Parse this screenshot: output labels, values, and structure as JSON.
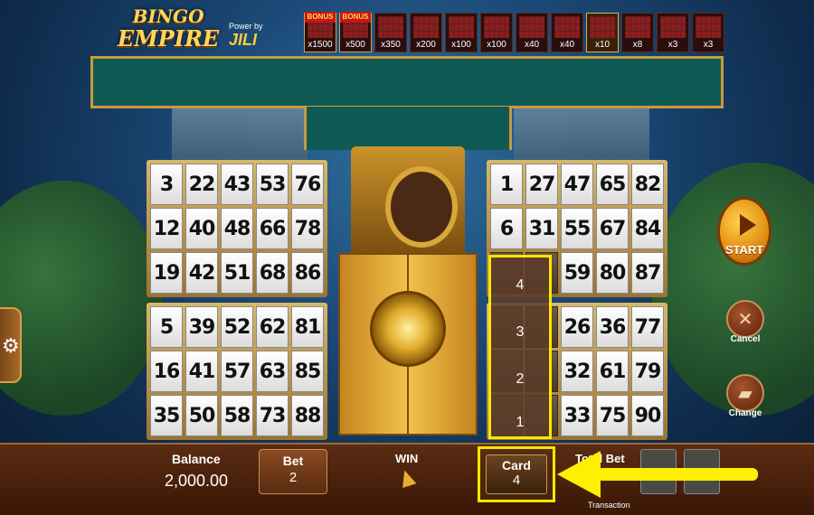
{
  "game": {
    "logo_line1": "BINGO",
    "logo_line2": "EMPIRE",
    "powered_by": "Power by",
    "brand": "JILI"
  },
  "patterns": [
    {
      "multiplier": "x1500",
      "bonus": "BONUS"
    },
    {
      "multiplier": "x500",
      "bonus": "BONUS"
    },
    {
      "multiplier": "x350",
      "bonus": ""
    },
    {
      "multiplier": "x200",
      "bonus": ""
    },
    {
      "multiplier": "x100",
      "bonus": ""
    },
    {
      "multiplier": "x100",
      "bonus": ""
    },
    {
      "multiplier": "x40",
      "bonus": ""
    },
    {
      "multiplier": "x40",
      "bonus": ""
    },
    {
      "multiplier": "x10",
      "bonus": ""
    },
    {
      "multiplier": "x8",
      "bonus": ""
    },
    {
      "multiplier": "x3",
      "bonus": ""
    },
    {
      "multiplier": "x3",
      "bonus": ""
    }
  ],
  "cards": [
    {
      "rows": [
        [
          "3",
          "22",
          "43",
          "53",
          "76"
        ],
        [
          "12",
          "40",
          "48",
          "66",
          "78"
        ],
        [
          "19",
          "42",
          "51",
          "68",
          "86"
        ]
      ]
    },
    {
      "rows": [
        [
          "1",
          "27",
          "47",
          "65",
          "82"
        ],
        [
          "6",
          "31",
          "55",
          "67",
          "84"
        ],
        [
          "",
          "",
          "59",
          "80",
          "87"
        ]
      ]
    },
    {
      "rows": [
        [
          "5",
          "39",
          "52",
          "62",
          "81"
        ],
        [
          "16",
          "41",
          "57",
          "63",
          "85"
        ],
        [
          "35",
          "50",
          "58",
          "73",
          "88"
        ]
      ]
    },
    {
      "rows": [
        [
          "",
          "",
          "26",
          "36",
          "77"
        ],
        [
          "",
          "",
          "32",
          "61",
          "79"
        ],
        [
          "",
          "",
          "33",
          "75",
          "90"
        ]
      ]
    }
  ],
  "card_selector": {
    "options": [
      "4",
      "3",
      "2",
      "1"
    ]
  },
  "bottom": {
    "balance_label": "Balance",
    "balance_value": "2,000.00",
    "bet_label": "Bet",
    "bet_value": "2",
    "win_label": "WIN",
    "card_label": "Card",
    "card_value": "4",
    "total_bet_label": "Total Bet",
    "transaction_label": "Transaction"
  },
  "side": {
    "start_label": "START",
    "cancel_label": "Cancel",
    "change_label": "Change"
  },
  "colors": {
    "highlight": "#ffef00",
    "banner": "#0f5a55",
    "gold": "#c99a3c"
  }
}
